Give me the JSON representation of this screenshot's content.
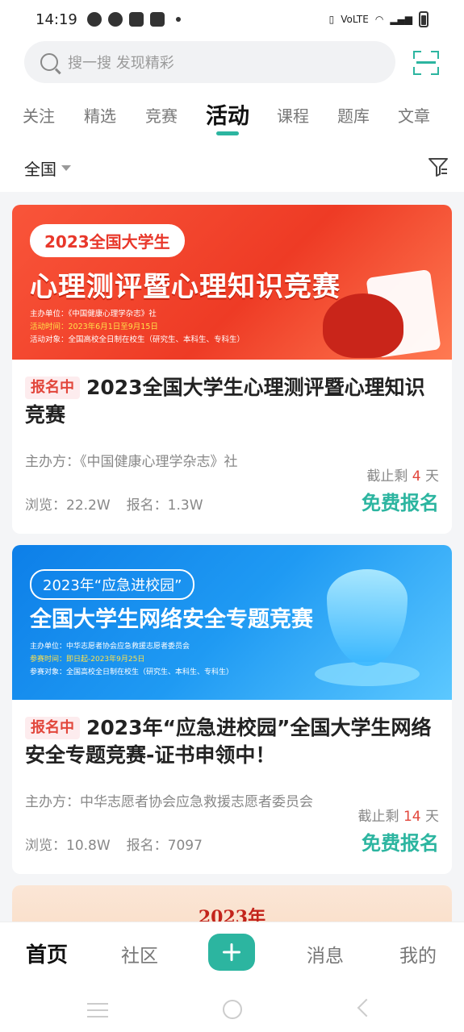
{
  "status_bar": {
    "time": "14:19",
    "network": "VoLTE"
  },
  "search": {
    "placeholder": "搜一搜 发现精彩"
  },
  "tabs": [
    {
      "label": "关注"
    },
    {
      "label": "精选"
    },
    {
      "label": "竞赛"
    },
    {
      "label": "活动",
      "active": true
    },
    {
      "label": "课程"
    },
    {
      "label": "题库"
    },
    {
      "label": "文章"
    }
  ],
  "filter": {
    "region": "全国"
  },
  "cards": [
    {
      "banner": {
        "pill": "2023全国大学生",
        "main": "心理测评暨心理知识竞赛",
        "info1": "主办单位：《中国健康心理学杂志》社",
        "info2": "活动时间：2023年6月1日至9月15日",
        "info3": "活动对象：全国高校全日制在校生（研究生、本科生、专科生）"
      },
      "tag": "报名中",
      "title": "2023全国大学生心理测评暨心理知识竞赛",
      "organizer": "主办方：《中国健康心理学杂志》社",
      "views": "浏览：22.2W",
      "signups": "报名：1.3W",
      "deadline_prefix": "截止剩",
      "deadline_num": "4",
      "deadline_suffix": "天",
      "action": "免费报名"
    },
    {
      "banner": {
        "pill": "2023年“应急进校园”",
        "main": "全国大学生网络安全专题竞赛",
        "info1": "主办单位：中华志愿者协会应急救援志愿者委员会",
        "info2": "参赛时间：即日起-2023年9月25日",
        "info3": "参赛对象：全国高校全日制在校生（研究生、本科生、专科生）"
      },
      "tag": "报名中",
      "title": "2023年“应急进校园”全国大学生网络安全专题竞赛-证书申领中！",
      "organizer": "主办方：中华志愿者协会应急救援志愿者委员会",
      "views": "浏览：10.8W",
      "signups": "报名：7097",
      "deadline_prefix": "截止剩",
      "deadline_num": "14",
      "deadline_suffix": "天",
      "action": "免费报名"
    },
    {
      "banner": {
        "title": "2023年"
      }
    }
  ],
  "bottom_nav": [
    {
      "label": "首页",
      "active": true
    },
    {
      "label": "社区"
    },
    {
      "label": "消息"
    },
    {
      "label": "我的"
    }
  ],
  "colors": {
    "accent": "#2cb5a0",
    "tag_red": "#e2463b"
  }
}
